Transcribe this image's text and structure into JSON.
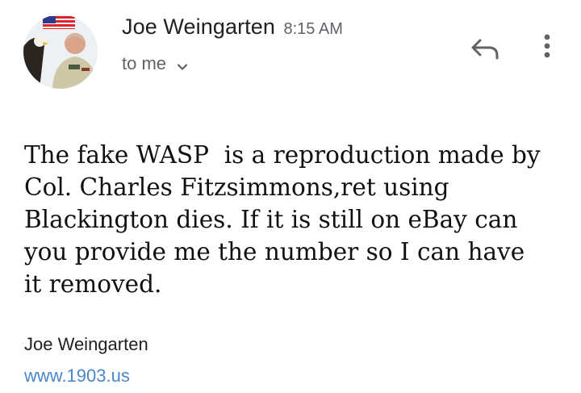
{
  "header": {
    "sender_name": "Joe Weingarten",
    "time": "8:15 AM",
    "recipient": "to me",
    "avatar_icon": "profile-photo-eagle-flag",
    "reply_icon": "reply-arrow-icon",
    "more_icon": "more-vert-icon"
  },
  "message": {
    "body": "The fake WASP  is a reproduction made by\nCol. Charles Fitzsimmons,ret using\nBlackington dies. If it is still on eBay can\nyou provide me the number so I can have\nit removed."
  },
  "signature": {
    "name": "Joe Weingarten",
    "link": "www.1903.us"
  },
  "colors": {
    "link": "#4a86c8",
    "secondary_text": "#5f6368",
    "icon": "#5f6368"
  }
}
